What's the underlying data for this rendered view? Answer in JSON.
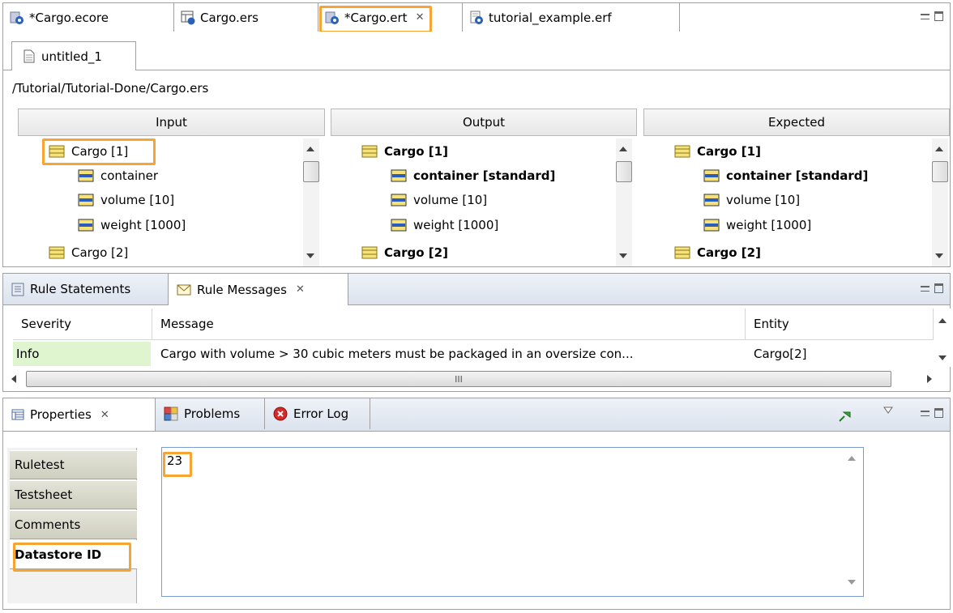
{
  "editor_tabs": [
    {
      "label": "*Cargo.ecore",
      "icon": "ecore-file-icon",
      "active": false
    },
    {
      "label": "Cargo.ers",
      "icon": "ers-file-icon",
      "active": false
    },
    {
      "label": "*Cargo.ert",
      "icon": "ert-file-icon",
      "active": true
    },
    {
      "label": "tutorial_example.erf",
      "icon": "erf-file-icon",
      "active": false
    }
  ],
  "subtab": {
    "label": "untitled_1",
    "icon": "document-icon"
  },
  "path": "/Tutorial/Tutorial-Done/Cargo.ers",
  "columns": {
    "input": "Input",
    "output": "Output",
    "expected": "Expected"
  },
  "input_tree": [
    "Cargo [1]",
    "container",
    "volume [10]",
    "weight [1000]",
    "Cargo [2]"
  ],
  "output_tree": [
    "Cargo [1]",
    "container [standard]",
    "volume [10]",
    "weight [1000]",
    "Cargo [2]"
  ],
  "expected_tree": [
    "Cargo [1]",
    "container [standard]",
    "volume [10]",
    "weight [1000]",
    "Cargo [2]"
  ],
  "rule_tabs": [
    {
      "label": "Rule Statements",
      "icon": "document-icon"
    },
    {
      "label": "Rule Messages",
      "icon": "envelope-icon"
    }
  ],
  "messages_table": {
    "headers": [
      "Severity",
      "Message",
      "Entity"
    ],
    "rows": [
      {
        "severity": "Info",
        "message": "Cargo with volume > 30 cubic meters must be packaged in an oversize con...",
        "entity": "Cargo[2]"
      }
    ],
    "scroll_marker": "III"
  },
  "props_tabs": [
    {
      "label": "Properties",
      "icon": "properties-icon"
    },
    {
      "label": "Problems",
      "icon": "problems-icon"
    },
    {
      "label": "Error Log",
      "icon": "error-log-icon"
    }
  ],
  "side_tabs": [
    "Ruletest",
    "Testsheet",
    "Comments",
    "Datastore ID"
  ],
  "datastore_value": "23",
  "colors": {
    "highlight": "#f7a432",
    "info_bg": "#dff5d0",
    "tab_gradient": "#dce3ee"
  }
}
